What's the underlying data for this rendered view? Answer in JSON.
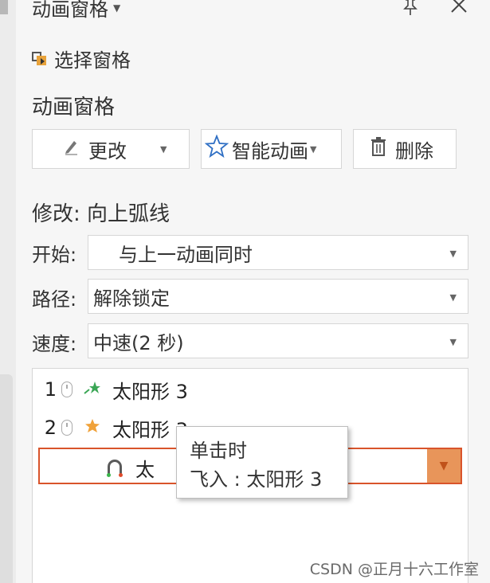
{
  "header": {
    "title": "动画窗格",
    "pin_icon": "pin-icon",
    "close_icon": "close-icon"
  },
  "selection_pane": {
    "label": "选择窗格"
  },
  "section_title": "动画窗格",
  "toolbar": {
    "change_label": "更改",
    "smart_label": "智能动画",
    "delete_label": "删除"
  },
  "modify_title": "修改: 向上弧线",
  "fields": {
    "start_label": "开始:",
    "start_value": "与上一动画同时",
    "path_label": "路径:",
    "path_value": "解除锁定",
    "speed_label": "速度:",
    "speed_value": "中速(2 秒)"
  },
  "animation_list": [
    {
      "num": "1",
      "name": "太阳形 3",
      "effect_color": "#3aa655"
    },
    {
      "num": "2",
      "name": "太阳形 3",
      "effect_color": "#f0a23a"
    }
  ],
  "selected_item": {
    "name": "太"
  },
  "tooltip": {
    "line1": "单击时",
    "line2": "飞入 : 太阳形 3"
  },
  "watermark": "CSDN @正月十六工作室",
  "colors": {
    "accent_border": "#d9542b",
    "dropdown_button": "#e8955a"
  }
}
